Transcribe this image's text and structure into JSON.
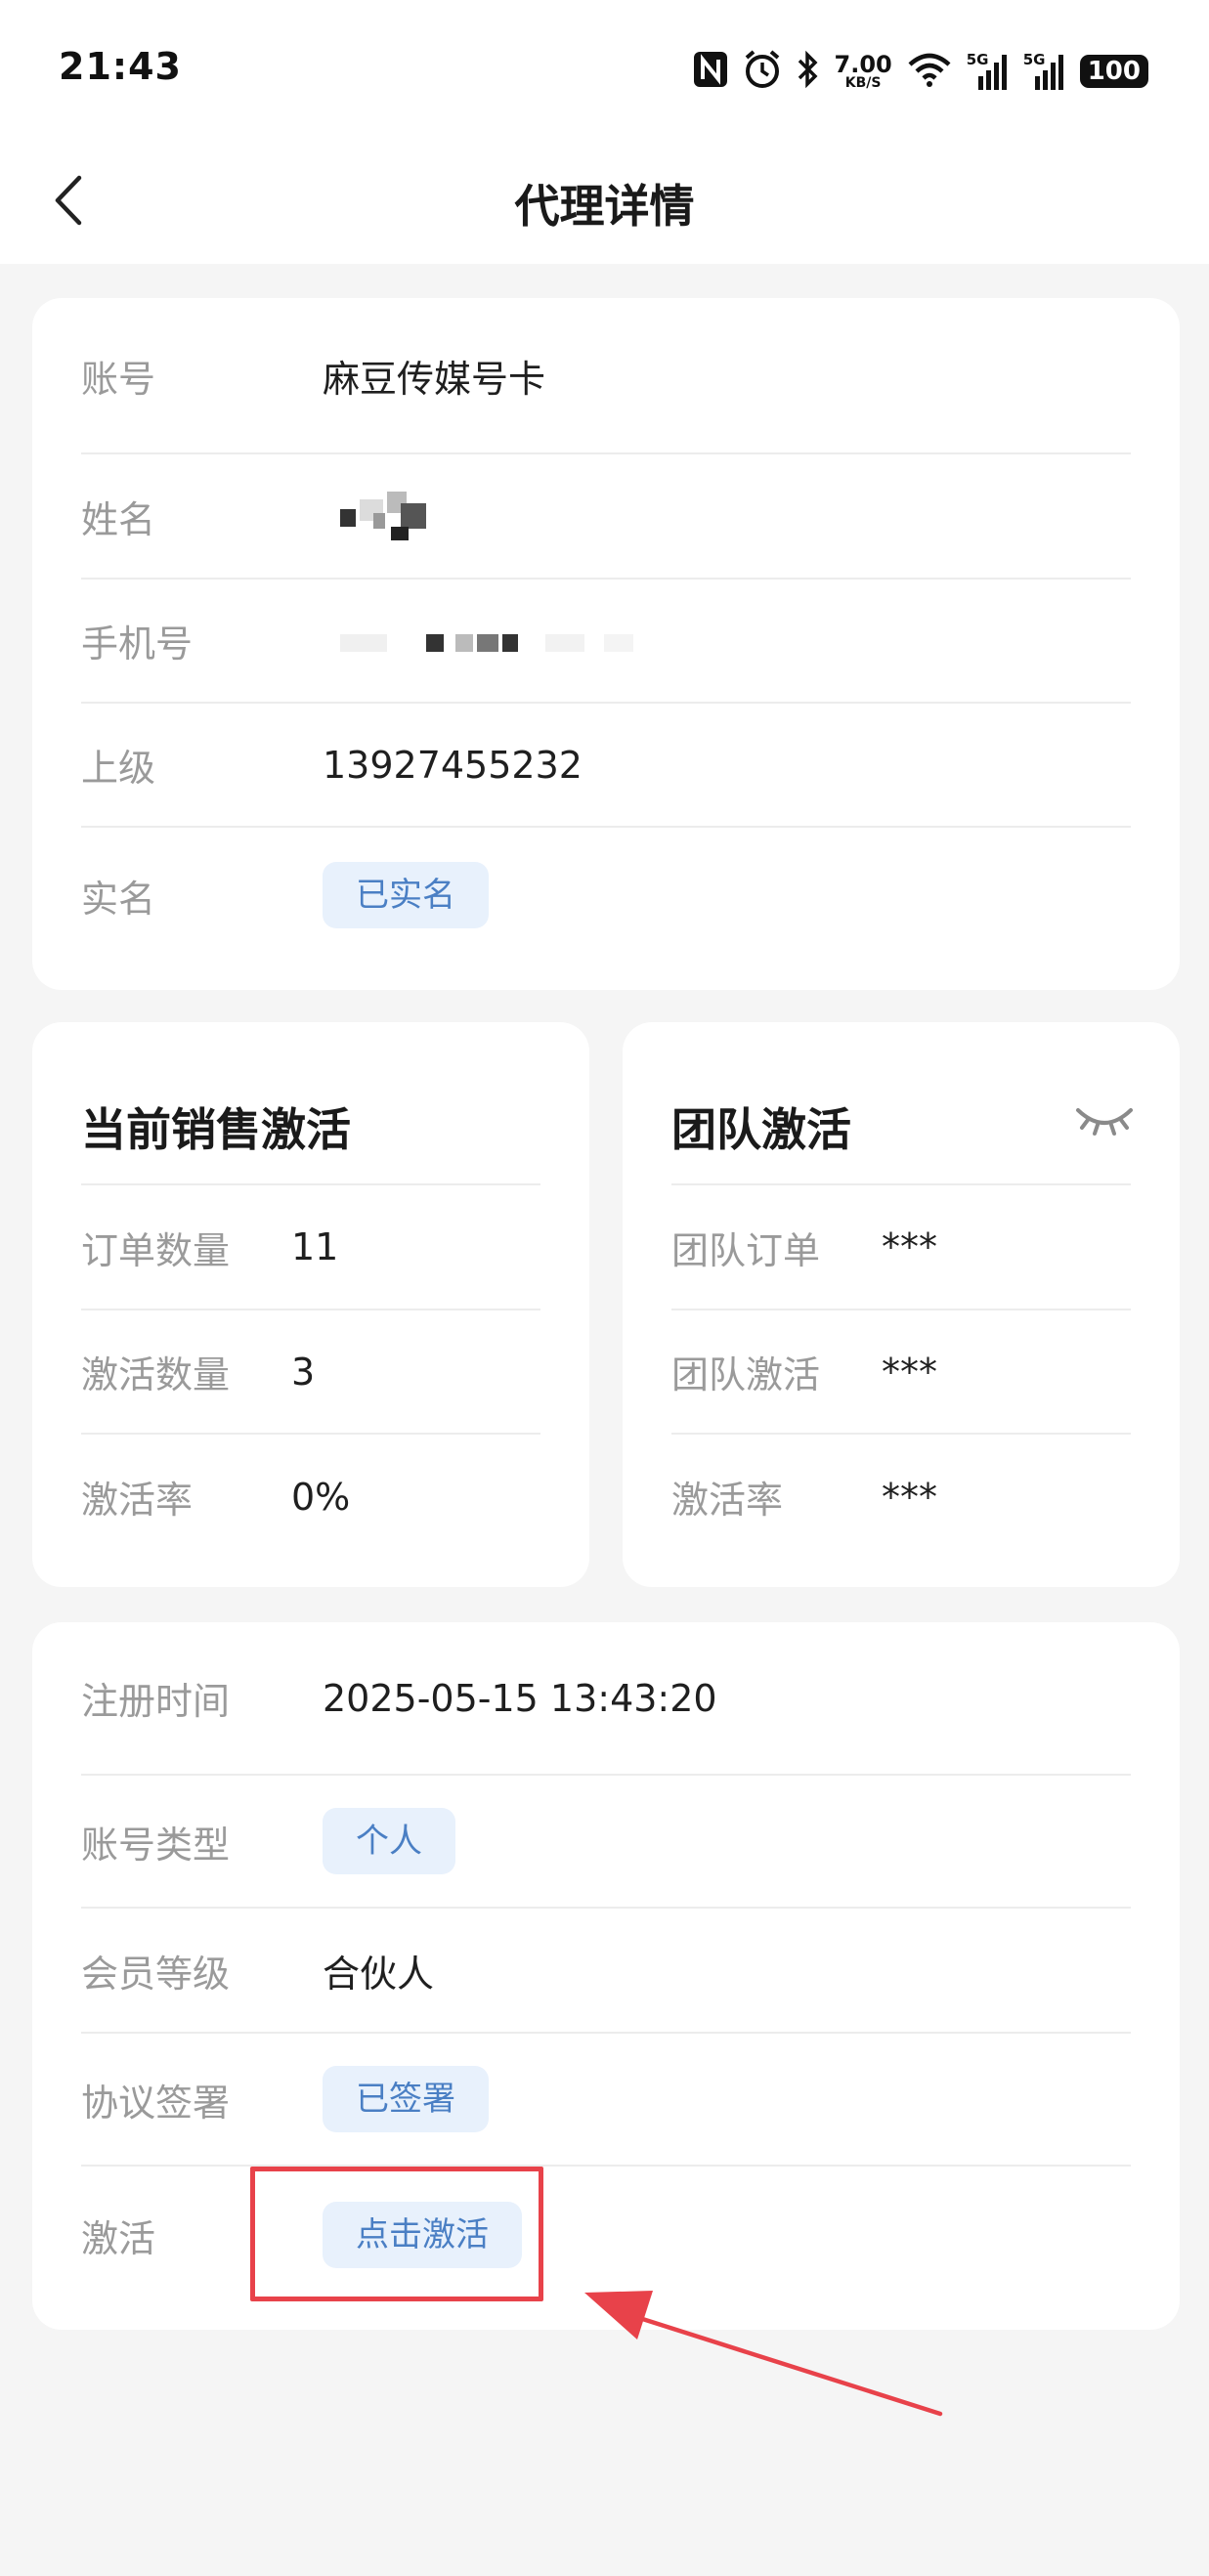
{
  "status_bar": {
    "time": "21:43",
    "speed_value": "7.00",
    "speed_unit": "KB/S",
    "net1": "5G",
    "net2": "5G",
    "battery": "100"
  },
  "nav": {
    "title": "代理详情"
  },
  "account_card": {
    "account_label": "账号",
    "account_value": "麻豆传媒号卡",
    "name_label": "姓名",
    "phone_label": "手机号",
    "superior_label": "上级",
    "superior_value": "13927455232",
    "realname_label": "实名",
    "realname_tag": "已实名"
  },
  "sales_card": {
    "title": "当前销售激活",
    "orders_label": "订单数量",
    "orders_value": "11",
    "activations_label": "激活数量",
    "activations_value": "3",
    "rate_label": "激活率",
    "rate_value": "0%"
  },
  "team_card": {
    "title": "团队激活",
    "orders_label": "团队订单",
    "orders_value": "***",
    "activations_label": "团队激活",
    "activations_value": "***",
    "rate_label": "激活率",
    "rate_value": "***"
  },
  "info_card": {
    "register_label": "注册时间",
    "register_value": "2025-05-15 13:43:20",
    "type_label": "账号类型",
    "type_tag": "个人",
    "level_label": "会员等级",
    "level_value": "合伙人",
    "agreement_label": "协议签署",
    "agreement_tag": "已签署",
    "activate_label": "激活",
    "activate_button": "点击激活"
  },
  "colors": {
    "tag_bg": "#e8f1fc",
    "tag_text": "#4a7fc4",
    "highlight": "#e8424a",
    "page_bg": "#f5f5f5"
  }
}
